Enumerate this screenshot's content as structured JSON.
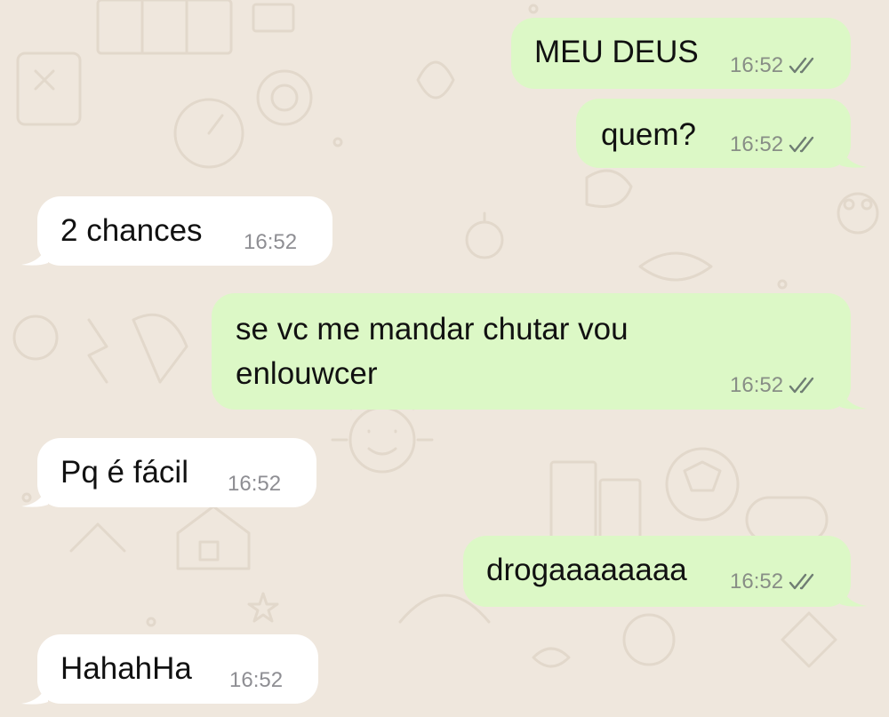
{
  "messages": [
    {
      "direction": "out",
      "text": "MEU DEUS",
      "time": "16:52",
      "status": "read"
    },
    {
      "direction": "out",
      "text": "quem?",
      "time": "16:52",
      "status": "read"
    },
    {
      "direction": "in",
      "text": "2 chances",
      "time": "16:52"
    },
    {
      "direction": "out",
      "text_line1": "se vc me mandar chutar vou",
      "text_line2": "enlouwcer",
      "time": "16:52",
      "status": "read"
    },
    {
      "direction": "in",
      "text": "Pq é fácil",
      "time": "16:52"
    },
    {
      "direction": "out",
      "text": "drogaaaaaaaa",
      "time": "16:52",
      "status": "read"
    },
    {
      "direction": "in",
      "text": "HahahHa",
      "time": "16:52"
    }
  ],
  "colors": {
    "outgoing_bubble": "#dcf8c6",
    "incoming_bubble": "#ffffff",
    "background": "#efe7dd",
    "timestamp": "#888e86"
  },
  "icons": {
    "read_receipt": "double-check-icon"
  }
}
